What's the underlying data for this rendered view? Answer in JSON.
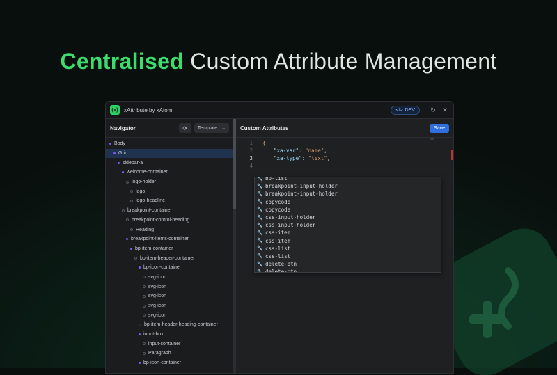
{
  "headline": {
    "accent": "Centralised",
    "rest": " Custom Attribute Management"
  },
  "window": {
    "title": "xAttribute by xAtom",
    "logo_glyph": "{x}",
    "dev_badge": "DEV",
    "dev_icon": "code-icon"
  },
  "navigator": {
    "title": "Navigator",
    "template_label": "Template",
    "tree": [
      {
        "label": "Body",
        "depth": 0,
        "filled": true,
        "selected": false
      },
      {
        "label": "Grid",
        "depth": 1,
        "filled": true,
        "selected": true
      },
      {
        "label": "sidebar-a",
        "depth": 2,
        "filled": true,
        "selected": false
      },
      {
        "label": "welcome-container",
        "depth": 3,
        "filled": true,
        "selected": false
      },
      {
        "label": "logo-holder",
        "depth": 4,
        "filled": false,
        "selected": false
      },
      {
        "label": "logo",
        "depth": 5,
        "filled": false,
        "selected": false
      },
      {
        "label": "logo-headline",
        "depth": 5,
        "filled": false,
        "selected": false
      },
      {
        "label": "breakpoint-container",
        "depth": 3,
        "filled": false,
        "selected": false
      },
      {
        "label": "breakpoint-control-heading",
        "depth": 4,
        "filled": false,
        "selected": false
      },
      {
        "label": "Heading",
        "depth": 5,
        "filled": false,
        "selected": false
      },
      {
        "label": "breakpoint-items-container",
        "depth": 4,
        "filled": true,
        "selected": false
      },
      {
        "label": "bp-item-container",
        "depth": 5,
        "filled": true,
        "selected": false
      },
      {
        "label": "bp-item-header-container",
        "depth": 6,
        "filled": false,
        "selected": false
      },
      {
        "label": "bp-icon-container",
        "depth": 7,
        "filled": true,
        "selected": false
      },
      {
        "label": "svg-icon",
        "depth": 8,
        "filled": false,
        "selected": false
      },
      {
        "label": "svg-icon",
        "depth": 8,
        "filled": false,
        "selected": false
      },
      {
        "label": "svg-icon",
        "depth": 8,
        "filled": false,
        "selected": false
      },
      {
        "label": "svg-icon",
        "depth": 8,
        "filled": false,
        "selected": false
      },
      {
        "label": "svg-icon",
        "depth": 8,
        "filled": false,
        "selected": false
      },
      {
        "label": "bp-item-header-heading-container",
        "depth": 7,
        "filled": false,
        "selected": false
      },
      {
        "label": "input-box",
        "depth": 7,
        "filled": true,
        "selected": false
      },
      {
        "label": "input-container",
        "depth": 8,
        "filled": false,
        "selected": false
      },
      {
        "label": "Paragraph",
        "depth": 8,
        "filled": false,
        "selected": false
      },
      {
        "label": "bp-icon-container",
        "depth": 7,
        "filled": true,
        "selected": false
      }
    ]
  },
  "main": {
    "title": "Custom Attributes",
    "save_label": "Save",
    "code_lines": [
      {
        "num": "1",
        "text": "{"
      },
      {
        "num": "2",
        "key": "\"xa-var\"",
        "value": "\"name\""
      },
      {
        "num": "3",
        "key": "\"xa-type\"",
        "value": "\"text\""
      },
      {
        "num": "4",
        "text": ""
      }
    ],
    "suggestions": [
      "bp-list",
      "breakpoint-input-holder",
      "breakpoint-input-holder",
      "copycode",
      "copycode",
      "css-input-holder",
      "css-input-holder",
      "css-item",
      "css-item",
      "css-list",
      "css-list",
      "delete-btn",
      "delete-btn"
    ]
  },
  "colors": {
    "accent": "#3ddc6e",
    "save": "#2f6fe0",
    "dot": "#7b5cff",
    "selected_row": "#1f3350"
  }
}
